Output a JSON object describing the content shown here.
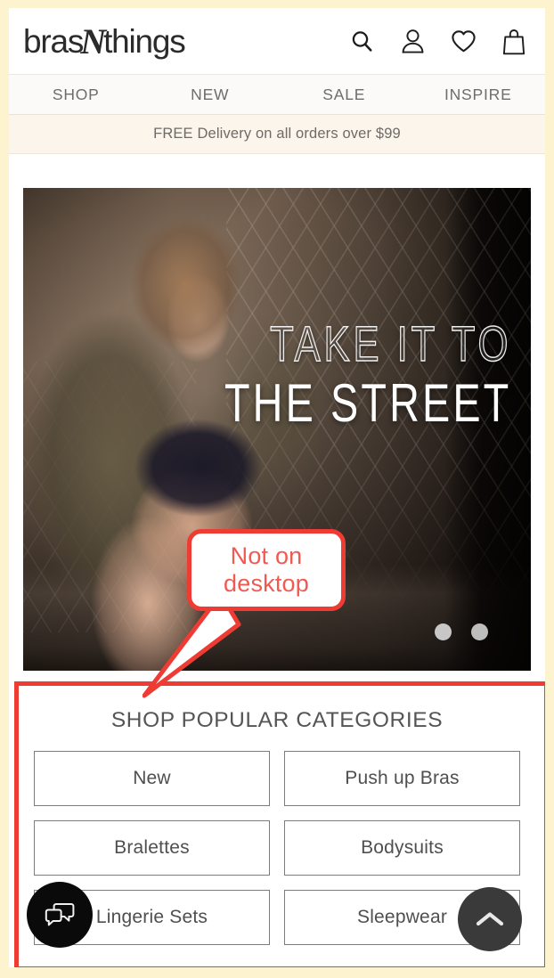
{
  "site": {
    "logo_prefix": "bras",
    "logo_mark": "N",
    "logo_suffix": "things"
  },
  "header": {
    "icons": [
      {
        "name": "search-icon",
        "label": "Search"
      },
      {
        "name": "account-icon",
        "label": "Account"
      },
      {
        "name": "wishlist-heart-icon",
        "label": "Wishlist"
      },
      {
        "name": "shopping-bag-icon",
        "label": "Bag"
      }
    ]
  },
  "nav": {
    "items": [
      {
        "label": "SHOP"
      },
      {
        "label": "NEW"
      },
      {
        "label": "SALE"
      },
      {
        "label": "INSPIRE"
      }
    ]
  },
  "promo": {
    "text": "FREE Delivery on all orders over $99"
  },
  "hero": {
    "headline_line1": "TAKE IT TO",
    "headline_line2": "THE STREET",
    "dots": [
      {
        "active": false
      },
      {
        "active": true
      }
    ]
  },
  "annotation": {
    "callout_line1": "Not on",
    "callout_line2": "desktop",
    "color": "#ee3b33",
    "text_color": "#f05a52"
  },
  "categories": {
    "title": "SHOP POPULAR CATEGORIES",
    "items": [
      {
        "label": "New"
      },
      {
        "label": "Push up Bras"
      },
      {
        "label": "Bralettes"
      },
      {
        "label": "Bodysuits"
      },
      {
        "label": "Lingerie Sets"
      },
      {
        "label": "Sleepwear"
      }
    ]
  },
  "fabs": {
    "chat_label": "Chat",
    "scroll_top_label": "Back to top"
  },
  "colors": {
    "frame": "#fdf3cf",
    "promo_bg": "#fbf5ec",
    "nav_bg": "#fbfaf8",
    "annotation_red": "#ee3b33",
    "chat_fab": "#0a0a0a",
    "top_fab": "#3a3a3a"
  }
}
